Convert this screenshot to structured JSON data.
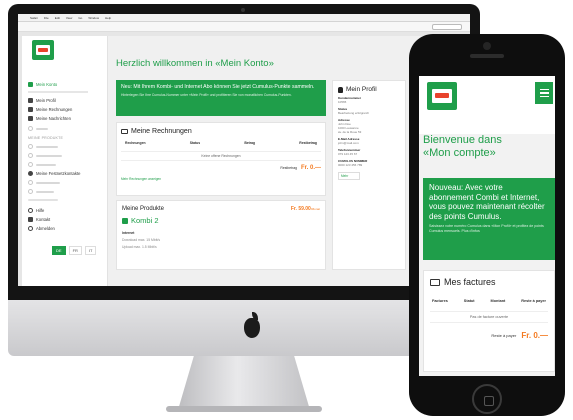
{
  "desktop": {
    "menubar": [
      "Safari",
      "File",
      "Edit",
      "View",
      "Go",
      "Window",
      "Help"
    ],
    "page_title": "Herzlich willkommen in «Mein Konto»",
    "sidebar": {
      "items_top": [
        {
          "label": "Mein Konto",
          "icon": "home-icon"
        },
        {
          "label": "Mein Profil",
          "icon": "person-icon"
        },
        {
          "label": "Meine Rechnungen",
          "icon": "invoice-icon"
        },
        {
          "label": "Meine Nachrichten",
          "icon": "mail-icon"
        }
      ],
      "section_products": "MEINE PRODUKTE",
      "item_bottom_1": {
        "label": "Meine Festnetzkontakte",
        "icon": "phone-icon"
      },
      "items_help": [
        {
          "label": "Hilfe",
          "icon": "help-icon"
        },
        {
          "label": "Kontakt",
          "icon": "contact-icon"
        },
        {
          "label": "Abmelden",
          "icon": "logout-icon"
        }
      ],
      "languages": [
        {
          "label": "DE",
          "active": true
        },
        {
          "label": "FR",
          "active": false
        },
        {
          "label": "IT",
          "active": false
        }
      ]
    },
    "banner": {
      "headline": "Neu: Mit Ihrem Kombi- und Internet Abo können Sie jetzt Cumulus-Punkte sammeln.",
      "subtext": "Hinterlegen Sie Ihre Cumulus-Nummer unter «Mein Profil» und profitieren Sie von monatlichen Cumulus-Punkten."
    },
    "invoices": {
      "title": "Meine Rechnungen",
      "headers": [
        "Rechnungen",
        "Status",
        "Betrag",
        "Restbetrag"
      ],
      "empty_text": "Keine offene Rechnungen",
      "footer_label": "Restbetrag",
      "footer_value": "Fr. 0.—",
      "link": "Mehr Rechnungen anzeigen"
    },
    "products": {
      "title": "Meine Produkte",
      "price": "Fr. 59.00",
      "price_unit": "/Monat",
      "product_name": "Kombi 2",
      "line_internet": "Internet",
      "line_download": "Download max. 15 Mbit/s",
      "line_upload": "Upload max. 1.5 Mbit/s"
    },
    "profile": {
      "title": "Mein Profil",
      "fields": [
        {
          "label": "Kundennummer",
          "value": "10565"
        },
        {
          "label": "Status",
          "value": "Bearbeitung erfolgreich"
        },
        {
          "label": "Adresse",
          "value": "John Doe"
        },
        {
          "label": "",
          "value": "1000 Lausanne"
        },
        {
          "label": "",
          "value": "av. de la Roue 53"
        },
        {
          "label": "E-Mail Adresse",
          "value": "john@mail.com"
        },
        {
          "label": "Telefonnummer",
          "value": "079 123 45 67"
        },
        {
          "label": "CUMULUS NUMMER",
          "value": "0000 123 456 789"
        }
      ],
      "more_button": "Mehr"
    }
  },
  "mobile": {
    "title_line1": "Bienvenue dans",
    "title_line2": "«Mon compte»",
    "banner": {
      "headline": "Nouveau: Avec votre abonnement Combi et Internet, vous pouvez maintenant récolter des points Cumulus.",
      "subtext": "Saisissez votre numéro Cumulus dans «Mon Profil» et profitez de points Cumulus mensuels. Plus d'infos"
    },
    "invoices": {
      "title": "Mes factures",
      "headers": [
        "Factures",
        "Statut",
        "Montant",
        "Reste à payer"
      ],
      "empty_text": "Pas de facture ouverte",
      "footer_label": "Reste à payer",
      "footer_value": "Fr. 0.—"
    }
  },
  "colors": {
    "brand_green": "#1f9e4a",
    "accent_orange": "#f47a20",
    "logo_red": "#e8432c"
  }
}
